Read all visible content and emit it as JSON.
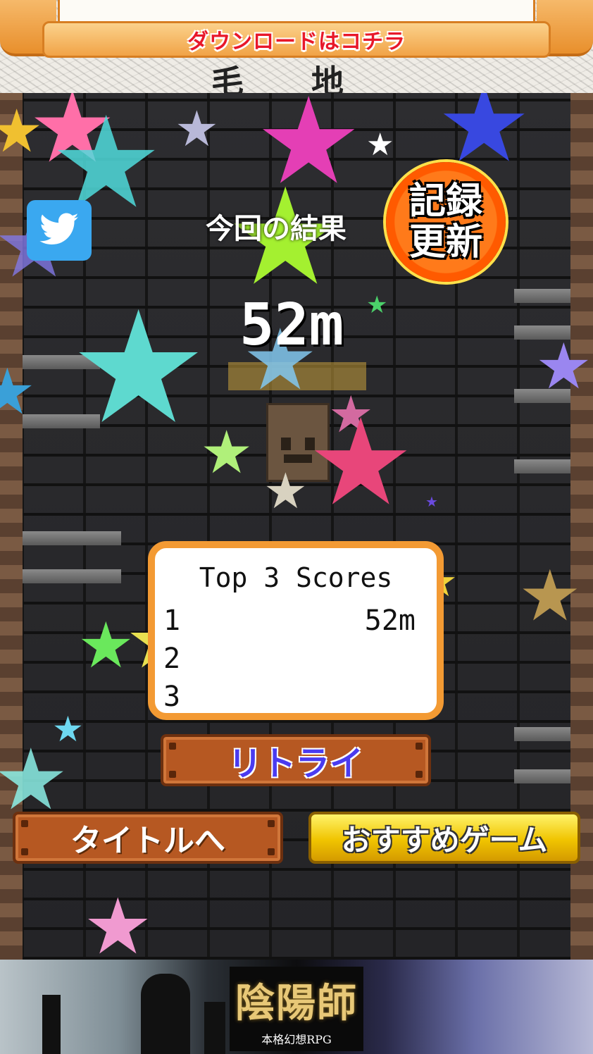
{
  "top_ad": {
    "download_label": "ダウンロードはコチラ",
    "artwork_text": "毛 地"
  },
  "game": {
    "result_label": "今回の結果",
    "distance": "52m",
    "record_badge": {
      "line1": "記録",
      "line2": "更新"
    },
    "share_icon": "twitter-icon",
    "scores": {
      "title": "Top 3 Scores",
      "rows": [
        {
          "rank": "1",
          "value": "52m"
        },
        {
          "rank": "2",
          "value": ""
        },
        {
          "rank": "3",
          "value": ""
        }
      ]
    },
    "buttons": {
      "retry": "リトライ",
      "title": "タイトルへ",
      "recommend": "おすすめゲーム"
    }
  },
  "bottom_ad": {
    "logo_main": "陰陽師",
    "logo_sub": "本格幻想RPG"
  },
  "colors": {
    "accent_orange": "#f39a33",
    "button_brown": "#b65822",
    "retry_text": "#4a3bf0",
    "recommend_gold": "#f0c400",
    "record_red": "#e8182a"
  }
}
